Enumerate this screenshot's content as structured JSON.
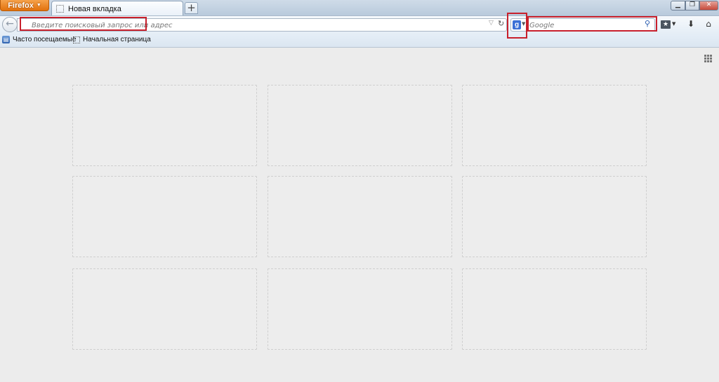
{
  "app_menu": {
    "label": "Firefox"
  },
  "tabs": [
    {
      "label": "Новая вкладка"
    }
  ],
  "new_tab_button": {
    "label": "+"
  },
  "navbar": {
    "urlbar_placeholder": "Введите поисковый запрос или адрес",
    "search_engine_icon": "g",
    "search_placeholder": "Google"
  },
  "bookmarks": [
    {
      "label": "Часто посещаемые"
    },
    {
      "label": "Начальная страница"
    }
  ],
  "icons": {
    "back": "back-arrow-icon",
    "reload": "reload-icon",
    "search_go": "magnifier-icon",
    "bookmarks_menu": "bookmarks-menu-icon",
    "downloads": "download-arrow-icon",
    "home": "home-icon",
    "tile_grid": "grid-icon"
  },
  "colors": {
    "firefox_button": "#e2710c",
    "highlight": "#c8202c"
  },
  "thumbnail_tiles": 9
}
